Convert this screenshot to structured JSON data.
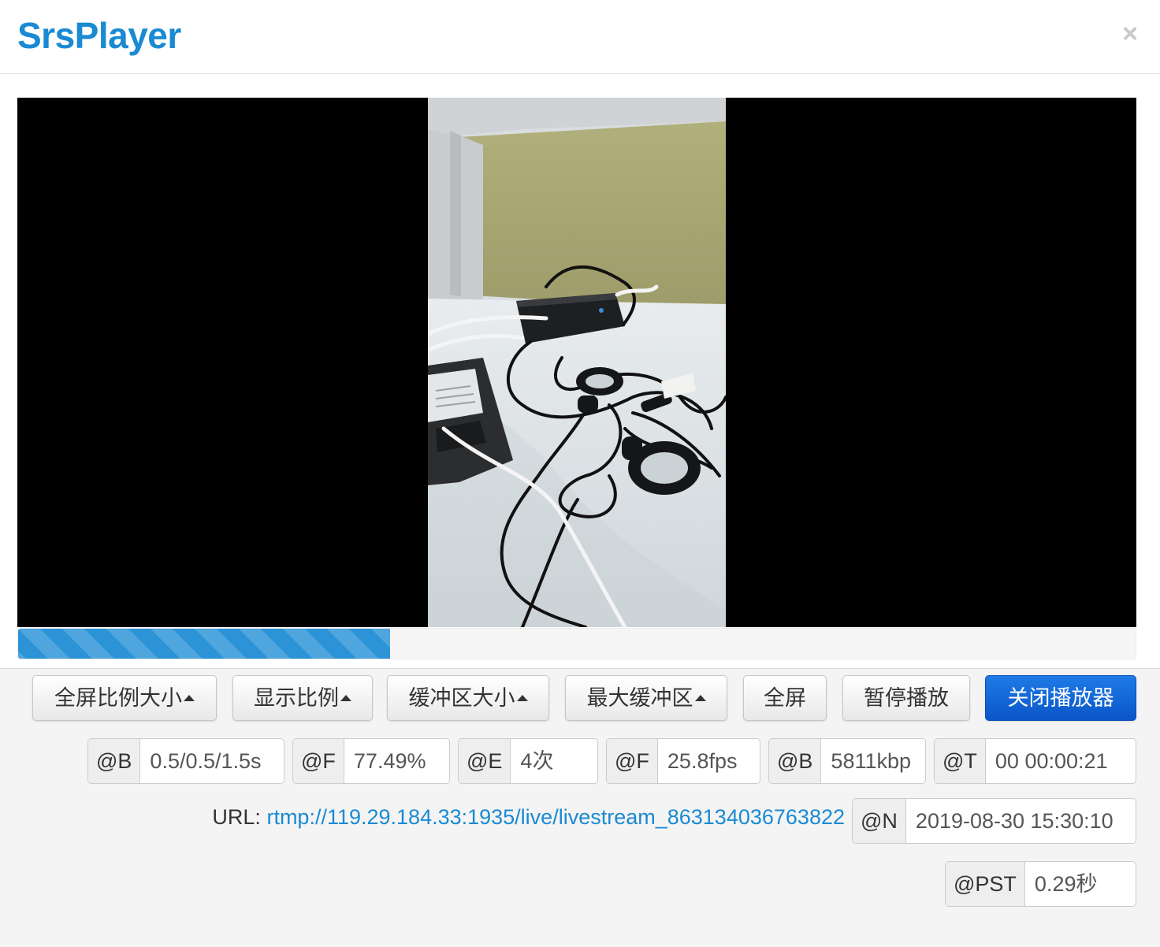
{
  "header": {
    "title": "SrsPlayer",
    "close_label": "×"
  },
  "player": {
    "progress_percent": 33.3
  },
  "controls": {
    "fullscreen_ratio": "全屏比例大小",
    "display_ratio": "显示比例",
    "buffer_size": "缓冲区大小",
    "max_buffer": "最大缓冲区",
    "fullscreen": "全屏",
    "pause": "暂停播放",
    "close_player": "关闭播放器"
  },
  "stats": {
    "buffer": {
      "label": "@B",
      "value": "0.5/0.5/1.5s"
    },
    "fps_ratio": {
      "label": "@F",
      "value": "77.49%"
    },
    "errors": {
      "label": "@E",
      "value": "4次"
    },
    "fps": {
      "label": "@F",
      "value": "25.8fps"
    },
    "bitrate": {
      "label": "@B",
      "value": "5811kbp"
    },
    "time": {
      "label": "@T",
      "value": "00 00:00:21"
    },
    "now": {
      "label": "@N",
      "value": "2019-08-30 15:30:10"
    },
    "pst": {
      "label": "@PST",
      "value": "0.29秒"
    }
  },
  "url": {
    "label": "URL:",
    "value": "rtmp://119.29.184.33:1935/live/livestream_863134036763822"
  },
  "colors": {
    "brand": "#1a8ad3",
    "primary_button": "#0b55c9"
  }
}
